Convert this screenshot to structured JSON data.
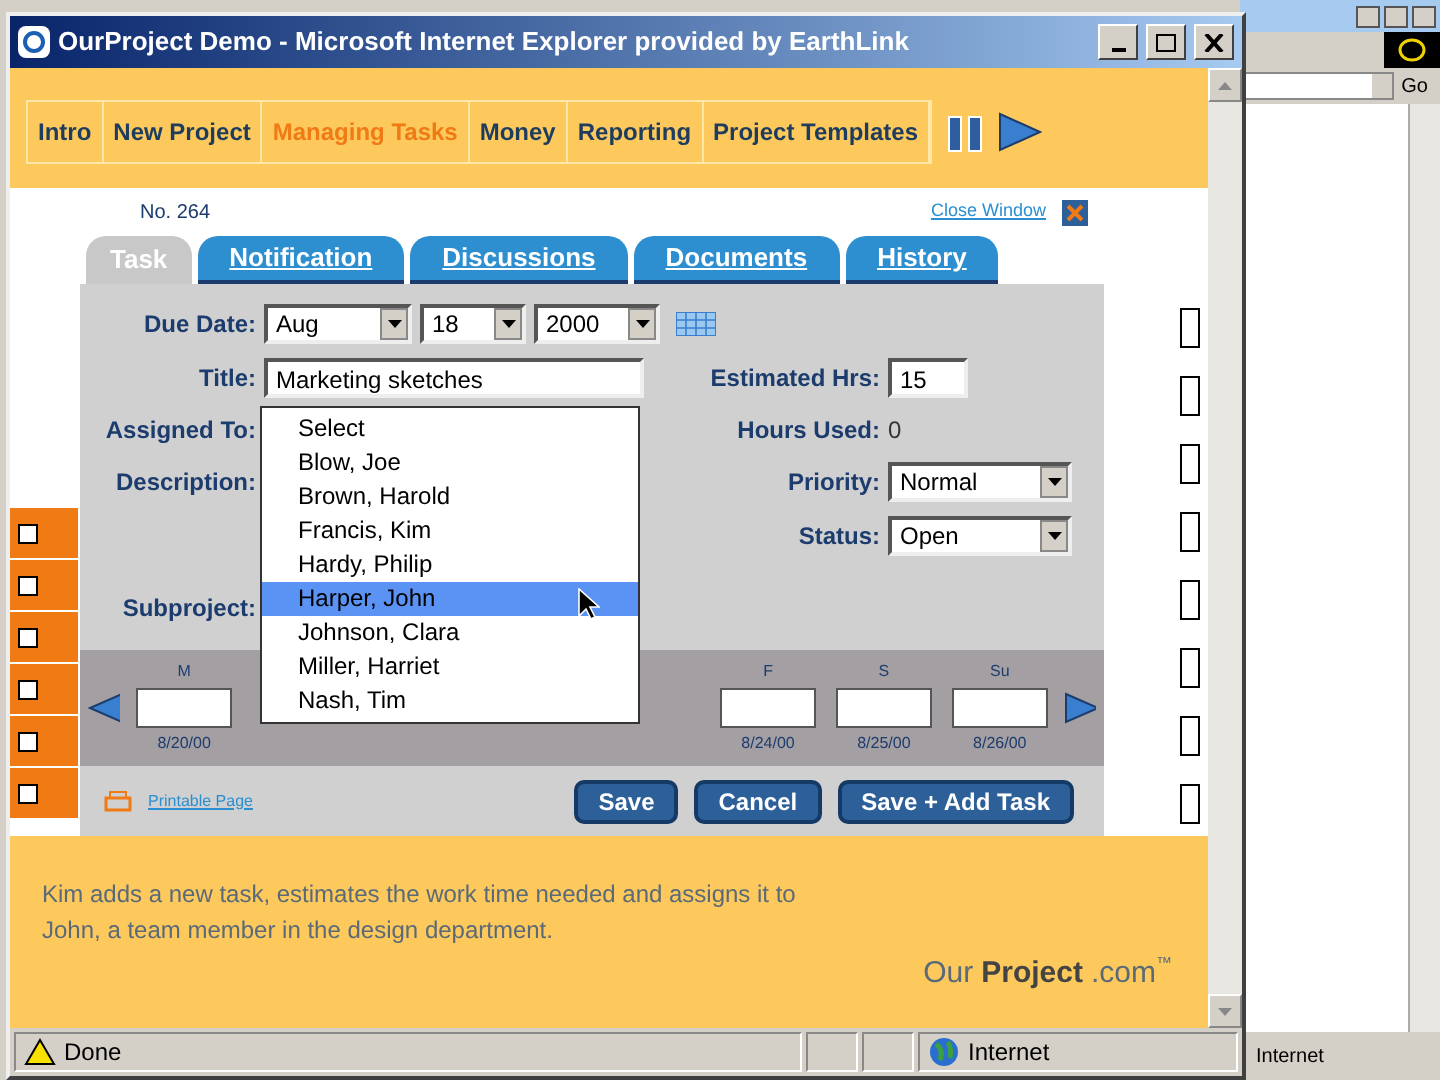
{
  "window": {
    "title": "OurProject Demo - Microsoft Internet Explorer provided by EarthLink"
  },
  "nav": {
    "items": [
      {
        "label": "Intro",
        "selected": false
      },
      {
        "label": "New Project",
        "selected": false
      },
      {
        "label": "Managing Tasks",
        "selected": true
      },
      {
        "label": "Money",
        "selected": false
      },
      {
        "label": "Reporting",
        "selected": false
      },
      {
        "label": "Project Templates",
        "selected": false
      }
    ]
  },
  "task_dialog": {
    "number": "No. 264",
    "close_link": "Close Window",
    "tabs": [
      {
        "label": "Task",
        "selected": true
      },
      {
        "label": "Notification",
        "selected": false
      },
      {
        "label": "Discussions",
        "selected": false
      },
      {
        "label": "Documents",
        "selected": false
      },
      {
        "label": "History",
        "selected": false
      }
    ],
    "due_date": {
      "label": "Due Date:",
      "month": "Aug",
      "day": "18",
      "year": "2000"
    },
    "title": {
      "label": "Title:",
      "value": "Marketing sketches"
    },
    "assigned_to": {
      "label": "Assigned To:",
      "options": [
        {
          "label": "Select",
          "selected": false
        },
        {
          "label": "Blow, Joe",
          "selected": false
        },
        {
          "label": "Brown, Harold",
          "selected": false
        },
        {
          "label": "Francis, Kim",
          "selected": false
        },
        {
          "label": "Hardy, Philip",
          "selected": false
        },
        {
          "label": "Harper, John",
          "selected": true
        },
        {
          "label": "Johnson, Clara",
          "selected": false
        },
        {
          "label": "Miller, Harriet",
          "selected": false
        },
        {
          "label": "Nash, Tim",
          "selected": false
        }
      ]
    },
    "description": {
      "label": "Description:"
    },
    "subproject": {
      "label": "Subproject:"
    },
    "estimated_hrs": {
      "label": "Estimated Hrs:",
      "value": "15"
    },
    "hours_used": {
      "label": "Hours Used:",
      "value": "0"
    },
    "priority": {
      "label": "Priority:",
      "value": "Normal"
    },
    "status": {
      "label": "Status:",
      "value": "Open"
    },
    "week": {
      "days": [
        {
          "day": "M",
          "date": "8/20/00"
        },
        {
          "day": "F",
          "date": "8/24/00"
        },
        {
          "day": "S",
          "date": "8/25/00"
        },
        {
          "day": "Su",
          "date": "8/26/00"
        }
      ]
    },
    "printable_link": "Printable Page",
    "buttons": [
      "Save",
      "Cancel",
      "Save + Add Task"
    ]
  },
  "caption": "Kim adds a new task, estimates the work time needed and assigns it to John, a team member in the design department.",
  "logo": {
    "our": "Our",
    "project": "Project",
    "domain": ".com",
    "tm": "™"
  },
  "status_bar": {
    "text": "Done",
    "zone": "Internet"
  },
  "background_window": {
    "go_button": "Go",
    "status_zone": "Internet"
  },
  "background_page": {
    "left_rows": [
      {
        "checked": false
      },
      {
        "checked": false
      },
      {
        "checked": false
      },
      {
        "checked": false
      },
      {
        "checked": false
      },
      {
        "checked": false
      }
    ],
    "right_rows": [
      {
        "checked": false
      },
      {
        "checked": false
      },
      {
        "checked": false
      },
      {
        "checked": false
      },
      {
        "checked": false
      },
      {
        "checked": false
      },
      {
        "checked": false
      },
      {
        "checked": false
      }
    ]
  }
}
